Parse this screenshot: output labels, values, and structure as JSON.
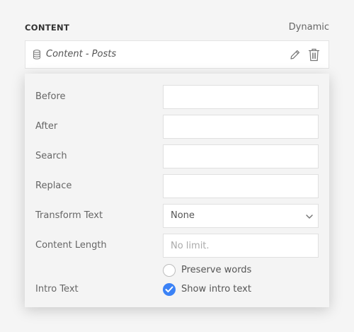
{
  "section": {
    "title": "CONTENT",
    "mode": "Dynamic"
  },
  "source": {
    "label": "Content - Posts",
    "icon": "database-icon"
  },
  "fields": {
    "before": {
      "label": "Before",
      "value": ""
    },
    "after": {
      "label": "After",
      "value": ""
    },
    "search": {
      "label": "Search",
      "value": ""
    },
    "replace": {
      "label": "Replace",
      "value": ""
    },
    "transform": {
      "label": "Transform Text",
      "value": "None"
    },
    "content_length": {
      "label": "Content Length",
      "placeholder": "No limit.",
      "value": ""
    },
    "preserve_words": {
      "label": "Preserve words",
      "checked": false
    },
    "intro_text": {
      "label": "Intro Text",
      "option_label": "Show intro text",
      "checked": true
    }
  },
  "colors": {
    "accent": "#3b82f6",
    "background": "#f5f5f5",
    "panel": "#f4f4f4"
  }
}
